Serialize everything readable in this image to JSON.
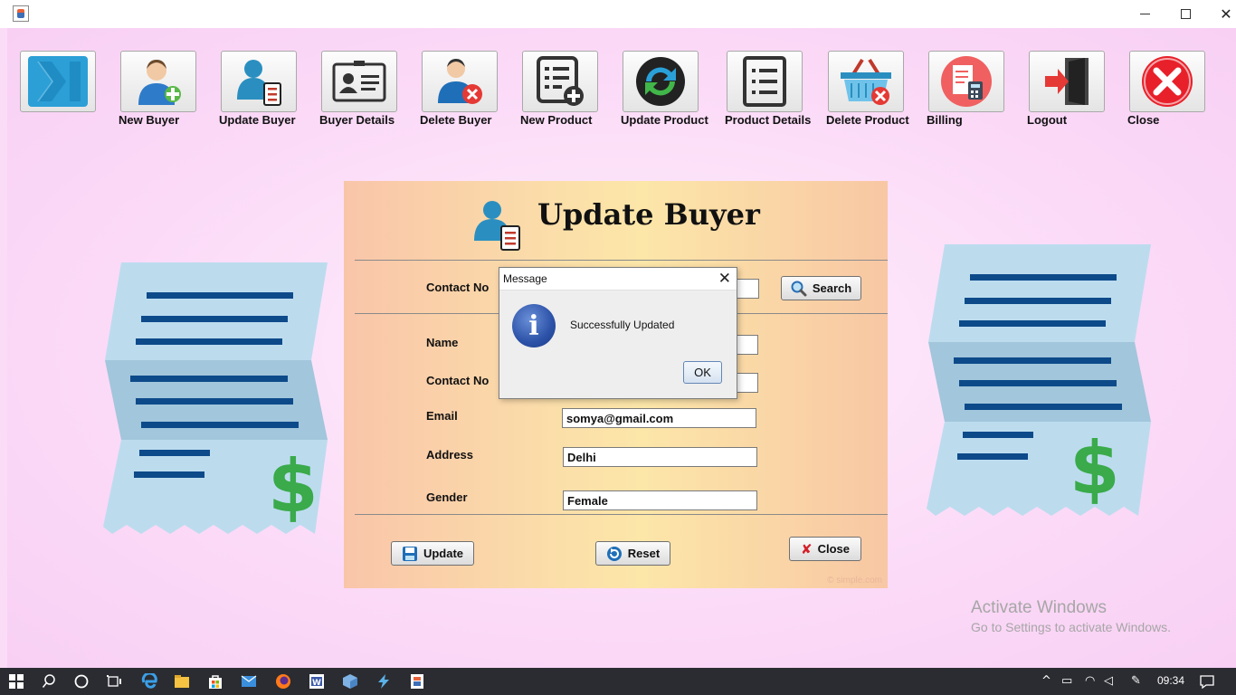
{
  "window": {
    "minimize_glyph": "",
    "close_glyph": "✕"
  },
  "toolbar": [
    {
      "label": "",
      "icon": "skip-icon"
    },
    {
      "label": "New Buyer",
      "icon": "add-user-icon"
    },
    {
      "label": "Update Buyer",
      "icon": "update-user-icon"
    },
    {
      "label": "Buyer Details",
      "icon": "id-card-icon"
    },
    {
      "label": "Delete Buyer",
      "icon": "delete-user-icon"
    },
    {
      "label": "New Product",
      "icon": "add-list-icon"
    },
    {
      "label": "Update Product",
      "icon": "refresh-icon"
    },
    {
      "label": "Product Details",
      "icon": "list-icon"
    },
    {
      "label": "Delete Product",
      "icon": "delete-basket-icon"
    },
    {
      "label": "Billing",
      "icon": "billing-icon"
    },
    {
      "label": "Logout",
      "icon": "logout-icon"
    },
    {
      "label": "Close",
      "icon": "close-circle-icon"
    }
  ],
  "form": {
    "title": "Update Buyer",
    "search_label": "Contact No",
    "search_value": "",
    "search_button": "Search",
    "fields": [
      {
        "label": "Name",
        "value": ""
      },
      {
        "label": "Contact No",
        "value": ""
      },
      {
        "label": "Email",
        "value": "somya@gmail.com"
      },
      {
        "label": "Address",
        "value": "Delhi"
      },
      {
        "label": "Gender",
        "value": "Female"
      }
    ],
    "update_button": "Update",
    "reset_button": "Reset",
    "close_button": "Close"
  },
  "dialog": {
    "title": "Message",
    "message": "Successfully Updated",
    "ok_label": "OK",
    "info_glyph": "i"
  },
  "activation": {
    "title": "Activate Windows",
    "subtitle": "Go to Settings to activate Windows."
  },
  "taskbar": {
    "time": "09:34"
  },
  "colors": {
    "background": "#fbdcf7",
    "panel_left": "#f9c5a9",
    "panel_center": "#fce6a8",
    "receipt": "#bcdcee",
    "receipt_lines": "#0d4a8a",
    "dollar": "#3aaa4a"
  }
}
